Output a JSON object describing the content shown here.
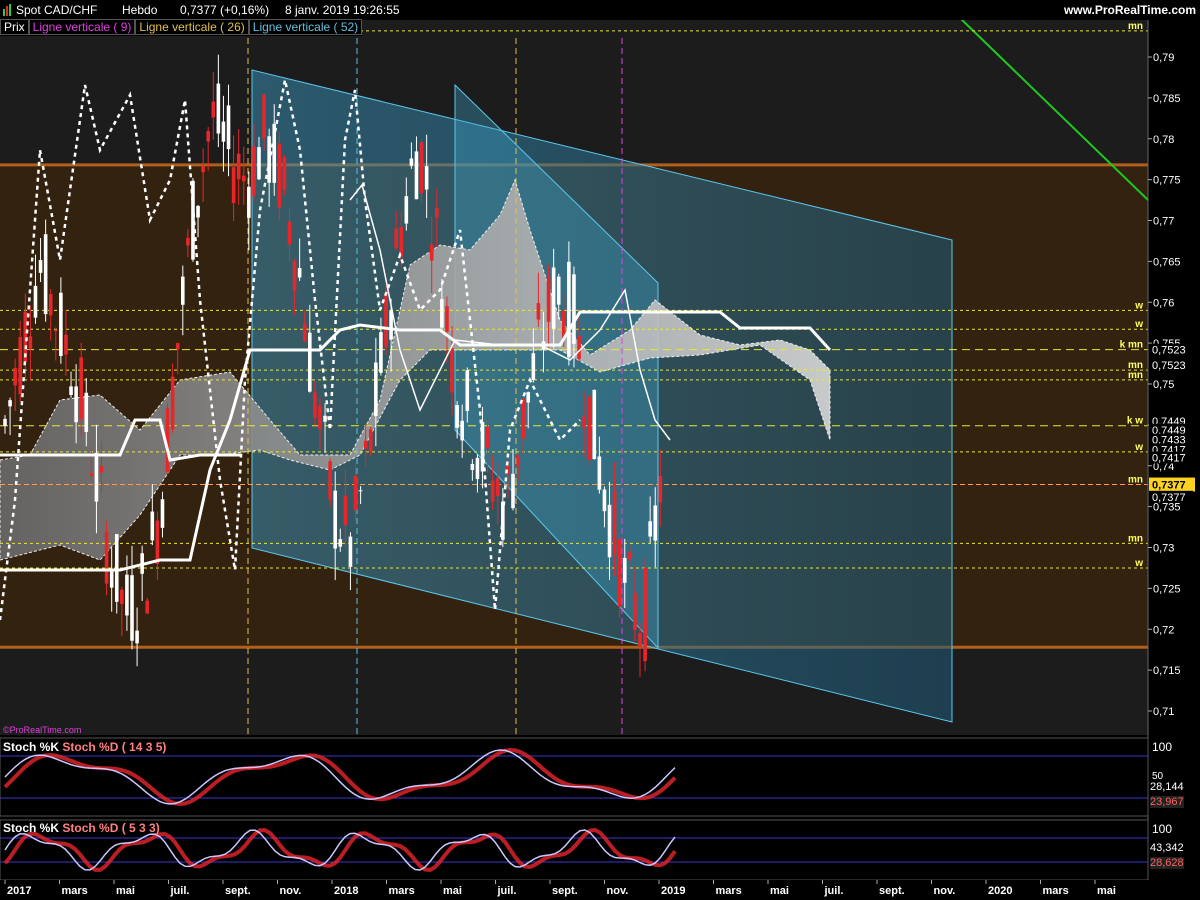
{
  "header": {
    "instrument": "Spot CAD/CHF",
    "period": "Hebdo",
    "last": "0,7377 (+0,16%)",
    "datetime": "8 janv. 2019 19:26:55",
    "site": "www.ProRealTime.com"
  },
  "legend": {
    "prix": "Prix",
    "lv9": "Ligne verticale ( 9)",
    "lv26": "Ligne verticale ( 26)",
    "lv52": "Ligne verticale ( 52)"
  },
  "watermark": "©ProRealTime.com",
  "price_axis": {
    "ticks": [
      "0,79",
      "0,785",
      "0,78",
      "0,775",
      "0,77",
      "0,765",
      "0,76",
      "0,755",
      "0,75",
      "0,745",
      "0,74",
      "0,735",
      "0,73",
      "0,725",
      "0,72",
      "0,715",
      "0,71"
    ]
  },
  "levels": [
    {
      "tag": "mn",
      "price": 0.7932,
      "style": "dot"
    },
    {
      "tag": "w",
      "price": 0.759,
      "style": "dot"
    },
    {
      "tag": "w",
      "price": 0.7567,
      "style": "dot"
    },
    {
      "tag": "k mn",
      "price": 0.7542,
      "style": "dash"
    },
    {
      "tag": "mn",
      "price": 0.7517,
      "style": "dot"
    },
    {
      "tag": "mn",
      "price": 0.7505,
      "style": "dot"
    },
    {
      "tag": "k w",
      "price": 0.7449,
      "style": "dash"
    },
    {
      "tag": "w",
      "price": 0.7417,
      "style": "dot"
    },
    {
      "tag": "mn",
      "price": 0.7377,
      "style": "orange"
    },
    {
      "tag": "mn",
      "price": 0.7305,
      "style": "dot"
    },
    {
      "tag": "w",
      "price": 0.7275,
      "style": "dot"
    }
  ],
  "value_labels": [
    {
      "text": "0,7523",
      "price": 0.7542,
      "box": false
    },
    {
      "text": "0,7523",
      "price": 0.7523,
      "box": false
    },
    {
      "text": "0,7449",
      "price": 0.7455,
      "box": false
    },
    {
      "text": "0,7449",
      "price": 0.7444,
      "box": false
    },
    {
      "text": "0,7433",
      "price": 0.7432,
      "box": false
    },
    {
      "text": "0,7417",
      "price": 0.742,
      "box": false
    },
    {
      "text": "0,7417",
      "price": 0.741,
      "box": false
    },
    {
      "text": "0,7377",
      "price": 0.7377,
      "box": true
    },
    {
      "text": "0,7377",
      "price": 0.7362,
      "box": false
    }
  ],
  "stoch1": {
    "label_k": "Stoch %K",
    "label_d": "Stoch %D ( 14 3 5)",
    "ticks": [
      "100",
      "50"
    ],
    "v1": "28,144",
    "v2": "23,967"
  },
  "stoch2": {
    "label_k": "Stoch %K",
    "label_d": "Stoch %D ( 5 3 3)",
    "ticks": [
      "100"
    ],
    "v1": "43,342",
    "v2": "28,628"
  },
  "time_axis": [
    "2017",
    "mars",
    "mai",
    "juil.",
    "sept.",
    "nov.",
    "2018",
    "mars",
    "mai",
    "juil.",
    "sept.",
    "nov.",
    "2019",
    "mars",
    "mai",
    "juil.",
    "sept.",
    "nov.",
    "2020",
    "mars",
    "mai"
  ],
  "colors": {
    "up": "#ffffff",
    "down": "#e8262a",
    "channel": "#5bc8f0",
    "zone": "#3a2410",
    "zone_line": "#b0601a",
    "level": "#e8e832",
    "green": "#1ec81e",
    "lv9": "#e040e0",
    "lv26": "#e0c050",
    "lv52": "#60c0e0"
  }
}
